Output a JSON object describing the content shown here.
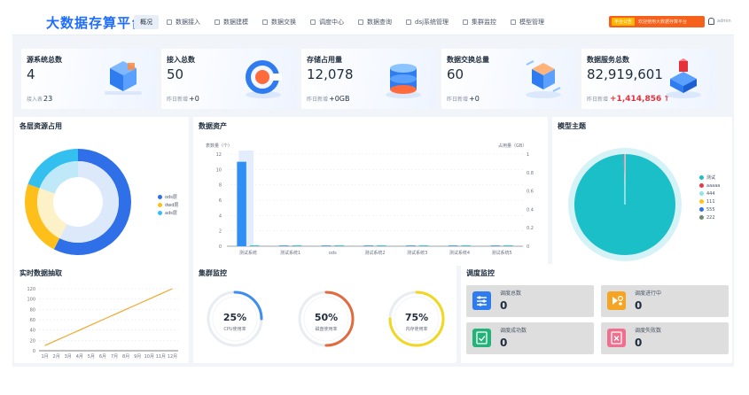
{
  "header": {
    "title": "大数据存算平台",
    "nav": [
      {
        "label": "概况",
        "active": true
      },
      {
        "label": "数据接入",
        "active": false
      },
      {
        "label": "数据建模",
        "active": false
      },
      {
        "label": "数据交换",
        "active": false
      },
      {
        "label": "调度中心",
        "active": false
      },
      {
        "label": "数据查询",
        "active": false
      },
      {
        "label": "dsj系统管理",
        "active": false
      },
      {
        "label": "集群监控",
        "active": false
      },
      {
        "label": "模型管理",
        "active": false
      }
    ],
    "notice_tag": "平台公告",
    "notice_text": "欢迎使用大数据存算平台",
    "user": "admin"
  },
  "stats": [
    {
      "title": "源系统总数",
      "value": "4",
      "sub_label": "接入表",
      "sub_value": "23",
      "icon": "cube-stack-icon"
    },
    {
      "title": "接入总数",
      "value": "50",
      "sub_label": "昨日新增",
      "sub_value": "+0",
      "icon": "magnet-icon"
    },
    {
      "title": "存储占用量",
      "value": "12,078",
      "sub_label": "昨日新增",
      "sub_value": "+0GB",
      "icon": "database-icon"
    },
    {
      "title": "数据交换总量",
      "value": "60",
      "sub_label": "昨日新增",
      "sub_value": "+0",
      "icon": "exchange-cube-icon"
    },
    {
      "title": "数据服务总数",
      "value": "82,919,601",
      "sub_label": "昨日新增",
      "sub_value": "+1,414,856",
      "sub_arrow": "↑",
      "icon": "service-cube-icon"
    }
  ],
  "resource": {
    "title": "各层资源占用",
    "chart_data": {
      "type": "pie",
      "series": [
        {
          "name": "ods层",
          "value": 50,
          "color": "#2f6fe8"
        },
        {
          "name": "dwd层",
          "value": 20,
          "color": "#ffbf1a"
        },
        {
          "name": "ads层",
          "value": 17,
          "color": "#33c0ef"
        }
      ],
      "inner_ring_colors": [
        "#dbe9fb",
        "#fdf1c8",
        "#bfe9f8"
      ]
    }
  },
  "assets": {
    "title": "数据资产",
    "chart_data": {
      "type": "bar",
      "categories": [
        "测试系统",
        "测试系统1",
        "ods",
        "测试系统2",
        "测试系统3",
        "测试系统4",
        "测试系统5"
      ],
      "series": [
        {
          "name": "表数量",
          "values": [
            11,
            0,
            0,
            0,
            0,
            0,
            0
          ],
          "color": "#2f8ff5"
        },
        {
          "name": "占用量",
          "values": [
            0,
            0,
            0,
            0,
            0,
            0,
            0
          ],
          "color": "#15b7c9"
        }
      ],
      "ylabel": "表数量（个）",
      "y2label": "占用量（GB）",
      "ylim": [
        0,
        12
      ],
      "y2lim": [
        0,
        1
      ],
      "yticks": [
        0,
        2,
        4,
        6,
        8,
        10,
        12
      ],
      "y2ticks": [
        0,
        0.2,
        0.4,
        0.6,
        0.8,
        1
      ],
      "grid": true
    }
  },
  "model": {
    "title": "模型主题",
    "chart_data": {
      "type": "pie",
      "series": [
        {
          "name": "测试",
          "value": 99.6,
          "color": "#1bbfc8"
        },
        {
          "name": "aaaaa",
          "value": 0.4,
          "color": "#e8394b"
        },
        {
          "name": "444",
          "value": 0,
          "color": "#8fe3f2"
        },
        {
          "name": "111",
          "value": 0,
          "color": "#ffc21a"
        },
        {
          "name": "555",
          "value": 0,
          "color": "#2f6fe8"
        },
        {
          "name": "222",
          "value": 0,
          "color": "#6e8a72"
        }
      ]
    }
  },
  "realtime": {
    "title": "实时数据抽取",
    "chart_data": {
      "type": "line",
      "categories": [
        "1月",
        "2月",
        "3月",
        "4月",
        "5月",
        "6月",
        "7月",
        "8月",
        "9月",
        "10月",
        "11月",
        "12月"
      ],
      "series": [
        {
          "name": "",
          "values": [
            10,
            20,
            30,
            40,
            50,
            60,
            70,
            80,
            90,
            100,
            110,
            120
          ],
          "color": "#f0a72e"
        }
      ],
      "ylim": [
        0,
        120
      ],
      "yticks": [
        0,
        20,
        40,
        60,
        80,
        100,
        120
      ],
      "grid": true
    }
  },
  "cluster": {
    "title": "集群监控",
    "gauges": [
      {
        "percent": 25,
        "label": "CPU使用率",
        "value_text": "25%",
        "color": "#3d8ef0"
      },
      {
        "percent": 50,
        "label": "磁盘使用率",
        "value_text": "50%",
        "color": "#e26a3d"
      },
      {
        "percent": 75,
        "label": "内存使用率",
        "value_text": "75%",
        "color": "#f2d722"
      }
    ]
  },
  "schedule": {
    "title": "调度监控",
    "items": [
      {
        "label": "调度总数",
        "value": "0",
        "color": "#2f7cf0",
        "icon": "sliders-icon"
      },
      {
        "label": "调度进行中",
        "value": "0",
        "color": "#f6a423",
        "icon": "play-gear-icon"
      },
      {
        "label": "调度成功数",
        "value": "0",
        "color": "#22b27a",
        "icon": "doc-check-icon"
      },
      {
        "label": "调度失败数",
        "value": "0",
        "color": "#f06e8e",
        "icon": "doc-cross-icon"
      }
    ]
  }
}
